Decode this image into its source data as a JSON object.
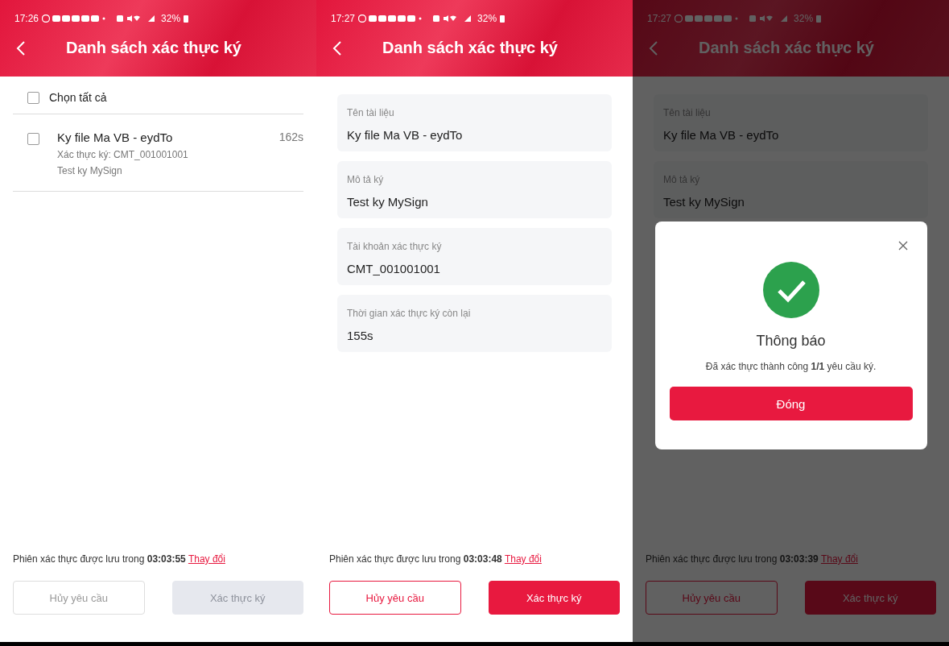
{
  "screens": [
    {
      "kind": "list",
      "status": {
        "time": "17:26",
        "battery": "32%"
      },
      "title": "Danh sách xác thực ký",
      "select_all": {
        "label": "Chọn tất cả",
        "checked": false
      },
      "items": [
        {
          "title": "Ky file Ma VB - eydTo",
          "subtitle": "Xác thực ký: CMT_001001001",
          "note": "Test ky MySign",
          "timer": "162s",
          "checked": false
        }
      ],
      "footer": {
        "text": "Phiên xác thực được lưu trong **03:03:55**",
        "link": "Thay đổi"
      },
      "buttons": [
        {
          "label": "Hủy yêu cầu",
          "kind": "outline",
          "disabled": true
        },
        {
          "label": "Xác thực ký",
          "kind": "primary",
          "disabled": true
        }
      ]
    },
    {
      "kind": "detail",
      "status": {
        "time": "17:27",
        "battery": "32%"
      },
      "title": "Danh sách xác thực ký",
      "fields": [
        {
          "label": "Tên tài liệu",
          "value": "Ky file Ma VB - eydTo"
        },
        {
          "label": "Mô tả ký",
          "value": "Test ky MySign"
        },
        {
          "label": "Tài khoản xác thực ký",
          "value": "CMT_001001001"
        },
        {
          "label": "Thời gian xác thực ký còn lại",
          "value": "155s"
        }
      ],
      "footer": {
        "text": "Phiên xác thực được lưu trong **03:03:48**",
        "link": "Thay đổi"
      },
      "buttons": [
        {
          "label": "Hủy yêu cầu",
          "kind": "outline",
          "disabled": false
        },
        {
          "label": "Xác thực ký",
          "kind": "primary",
          "disabled": false
        }
      ]
    },
    {
      "kind": "detail",
      "status": {
        "time": "17:27",
        "battery": "32%"
      },
      "title": "Danh sách xác thực ký",
      "fields": [
        {
          "label": "Tên tài liệu",
          "value": "Ky file Ma VB - eydTo"
        },
        {
          "label": "Mô tả ký",
          "value": "Test ky MySign"
        }
      ],
      "footer": {
        "text": "Phiên xác thực được lưu trong **03:03:39**",
        "link": "Thay đổi"
      },
      "buttons": [
        {
          "label": "Hủy yêu cầu",
          "kind": "outline",
          "disabled": false
        },
        {
          "label": "Xác thực ký",
          "kind": "primary",
          "disabled": false
        }
      ],
      "dialog": {
        "title": "Thông báo",
        "message": "Đã xác thực thành công **1/1** yêu cầu ký.",
        "button": "Đóng"
      }
    }
  ]
}
